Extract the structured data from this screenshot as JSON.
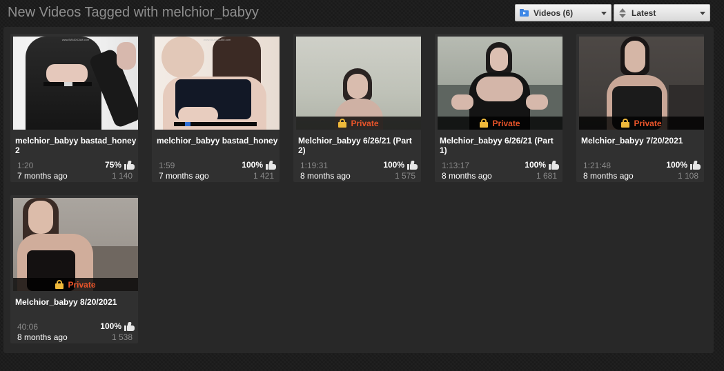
{
  "header": {
    "title": "New Videos Tagged with melchior_babyy",
    "type_filter": {
      "label": "Videos (6)",
      "icon": "folder-video-icon"
    },
    "sort_filter": {
      "label": "Latest",
      "icon": "sort-icon"
    }
  },
  "colors": {
    "private_text": "#e8542a",
    "lock": "#f0b93a",
    "panel": "#282828",
    "card": "#303030"
  },
  "videos": [
    {
      "title": "melchior_babyy bastad_honey 2",
      "duration": "1:20",
      "rating": "75%",
      "age": "7 months ago",
      "views": "1 140",
      "private": false,
      "private_label": ""
    },
    {
      "title": "melchior_babyy bastad_honey",
      "duration": "1:59",
      "rating": "100%",
      "age": "7 months ago",
      "views": "1 421",
      "private": false,
      "private_label": ""
    },
    {
      "title": "Melchior_babyy 6/26/21 (Part 2)",
      "duration": "1:19:31",
      "rating": "100%",
      "age": "8 months ago",
      "views": "1 575",
      "private": true,
      "private_label": "Private"
    },
    {
      "title": "Melchior_babyy 6/26/21 (Part 1)",
      "duration": "1:13:17",
      "rating": "100%",
      "age": "8 months ago",
      "views": "1 681",
      "private": true,
      "private_label": "Private"
    },
    {
      "title": "Melchior_babyy 7/20/2021",
      "duration": "1:21:48",
      "rating": "100%",
      "age": "8 months ago",
      "views": "1 108",
      "private": true,
      "private_label": "Private"
    },
    {
      "title": "Melchior_babyy 8/20/2021",
      "duration": "40:06",
      "rating": "100%",
      "age": "8 months ago",
      "views": "1 538",
      "private": true,
      "private_label": "Private"
    }
  ]
}
